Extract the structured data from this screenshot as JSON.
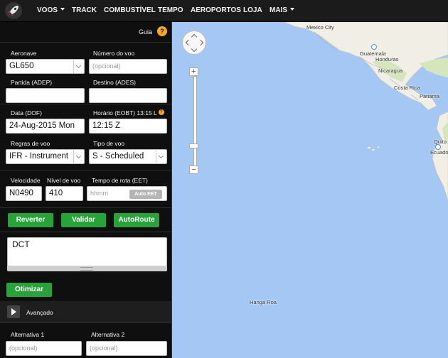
{
  "nav": {
    "items": [
      {
        "label": "VOOS",
        "dropdown": true
      },
      {
        "label": "TRACK",
        "dropdown": false
      },
      {
        "label": "COMBUSTÍVEL",
        "dropdown": false
      },
      {
        "label": "TEMPO",
        "dropdown": false
      },
      {
        "label": "AEROPORTOS",
        "dropdown": false
      },
      {
        "label": "LOJA",
        "dropdown": false
      },
      {
        "label": "MAIS",
        "dropdown": true
      }
    ]
  },
  "sidebar": {
    "help_label": "Guia",
    "help_icon": "?",
    "aircraft": {
      "label": "Aeronave",
      "value": "GL650"
    },
    "flight_number": {
      "label": "Número do voo",
      "placeholder": "(opcional)"
    },
    "departure": {
      "label": "Partida (ADEP)",
      "value": ""
    },
    "destination": {
      "label": "Destino (ADES)",
      "value": ""
    },
    "date": {
      "label": "Data (DOF)",
      "value": "24-Aug-2015 Mon"
    },
    "time": {
      "label": "Horário (EOBT) 13:15 L",
      "value": "12:15 Z",
      "info_icon": "?"
    },
    "flight_rules": {
      "label": "Regras de voo",
      "value": "IFR - Instrument"
    },
    "flight_type": {
      "label": "Tipo de voo",
      "value": "S - Scheduled"
    },
    "speed": {
      "label": "Velocidade",
      "value": "N0490"
    },
    "level": {
      "label": "Nível de voo",
      "value": "410"
    },
    "eet": {
      "label": "Tempo de rota (EET)",
      "placeholder": "hhmm",
      "button": "Auto EET"
    },
    "buttons": {
      "revert": "Reverter",
      "validate": "Validar",
      "autoroute": "AutoRoute"
    },
    "route": "DCT",
    "optimize": "Otimizar",
    "advanced": "Avançado",
    "alternate1": {
      "label": "Alternativa 1",
      "placeholder": "(opcional)"
    },
    "alternate2": {
      "label": "Alternativa 2",
      "placeholder": "(opcional)"
    }
  },
  "map": {
    "labels": {
      "mexico_city": "Mexico City",
      "guatemala": "Guatemala",
      "honduras": "Honduras",
      "nicaragua": "Nicaragua",
      "costa_rica": "Costa Rica",
      "panama": "Panama",
      "quito": "Quito",
      "ecuador": "Ecuador",
      "hanga_roa": "Hanga Roa"
    },
    "colors": {
      "water": "#a4c8f3",
      "land": "#f1eee6",
      "green": "#d6e6bc"
    }
  }
}
